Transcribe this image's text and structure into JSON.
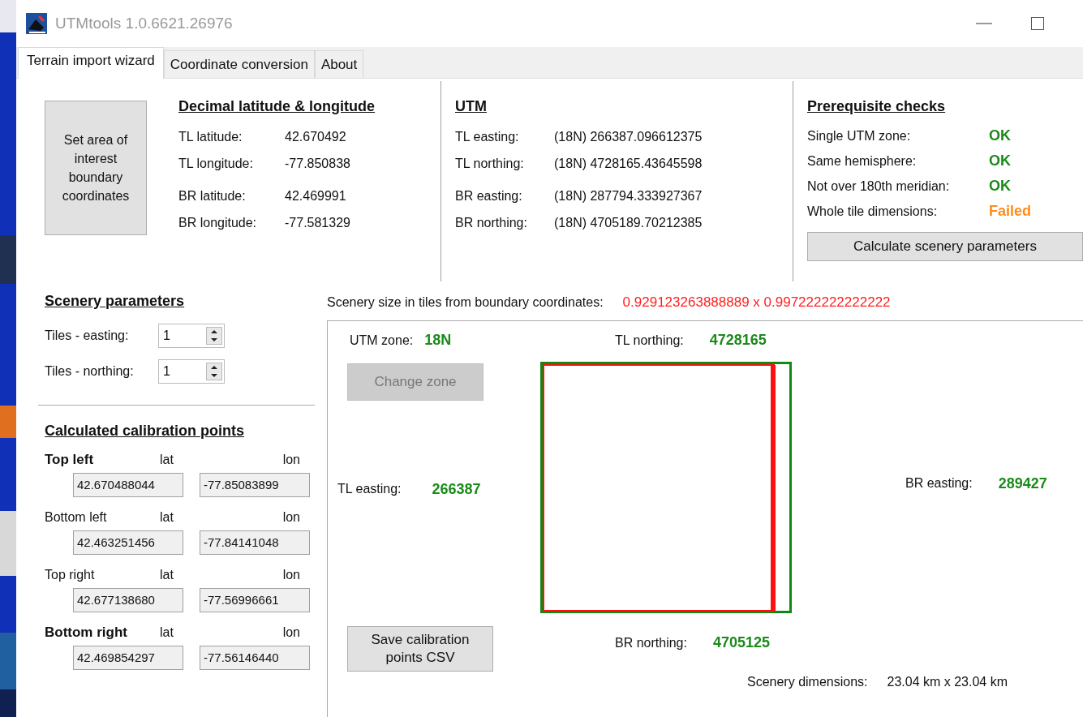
{
  "window": {
    "title": "UTMtools 1.0.6621.26976"
  },
  "tabs": [
    {
      "label": "Terrain import wizard",
      "selected": true
    },
    {
      "label": "Coordinate conversion",
      "selected": false
    },
    {
      "label": "About",
      "selected": false
    }
  ],
  "set_area_button": {
    "label": "Set area of interest boundary coordinates"
  },
  "decimal": {
    "heading": "Decimal latitude & longitude",
    "rows": [
      {
        "label": "TL latitude:",
        "value": "42.670492"
      },
      {
        "label": "TL longitude:",
        "value": "-77.850838"
      },
      {
        "label": "BR latitude:",
        "value": "42.469991"
      },
      {
        "label": "BR longitude:",
        "value": "-77.581329"
      }
    ]
  },
  "utm": {
    "heading": "UTM",
    "rows": [
      {
        "label": "TL easting:",
        "value": "(18N) 266387.096612375"
      },
      {
        "label": "TL northing:",
        "value": "(18N) 4728165.43645598"
      },
      {
        "label": "BR easting:",
        "value": "(18N) 287794.333927367"
      },
      {
        "label": "BR northing:",
        "value": "(18N) 4705189.70212385"
      }
    ]
  },
  "prerequisite_checks": {
    "heading": "Prerequisite checks",
    "checks": [
      {
        "label": "Single UTM zone:",
        "result": "OK",
        "color": "#1a8a1a"
      },
      {
        "label": "Same hemisphere:",
        "result": "OK",
        "color": "#1a8a1a"
      },
      {
        "label": "Not over 180th meridian:",
        "result": "OK",
        "color": "#1a8a1a"
      },
      {
        "label": "Whole tile dimensions:",
        "result": "Failed",
        "color": "#ff8c1a"
      }
    ],
    "button": "Calculate scenery parameters"
  },
  "scenery_parameters": {
    "heading": "Scenery parameters",
    "fields": [
      {
        "label": "Tiles - easting:",
        "value": "1"
      },
      {
        "label": "Tiles - northing:",
        "value": "1"
      }
    ]
  },
  "calibration": {
    "heading": "Calculated calibration points",
    "points": [
      {
        "name": "Top left",
        "emphasized": true,
        "lat_label": "lat",
        "lon_label": "lon",
        "lat": "42.670488044",
        "lon": "-77.85083899"
      },
      {
        "name": "Bottom left",
        "emphasized": false,
        "lat_label": "lat",
        "lon_label": "lon",
        "lat": "42.463251456",
        "lon": "-77.84141048"
      },
      {
        "name": "Top right",
        "emphasized": false,
        "lat_label": "lat",
        "lon_label": "lon",
        "lat": "42.677138680",
        "lon": "-77.56996661"
      },
      {
        "name": "Bottom right",
        "emphasized": true,
        "lat_label": "lat",
        "lon_label": "lon",
        "lat": "42.469854297",
        "lon": "-77.56146440"
      }
    ]
  },
  "scenery_size": {
    "label": "Scenery size in tiles from boundary coordinates:",
    "value": "0.929123263888889 x 0.997222222222222"
  },
  "preview": {
    "utm_zone_label": "UTM zone:",
    "utm_zone": "18N",
    "change_zone_button": {
      "label": "Change zone",
      "disabled": true
    },
    "tl_northing_label": "TL northing:",
    "tl_northing": "4728165",
    "tl_easting_label": "TL easting:",
    "tl_easting": "266387",
    "br_easting_label": "BR easting:",
    "br_easting": "289427",
    "br_northing_label": "BR northing:",
    "br_northing": "4705125",
    "save_button": "Save calibration points CSV",
    "dimensions_label": "Scenery dimensions:",
    "dimensions": "23.04 km x 23.04 km"
  }
}
